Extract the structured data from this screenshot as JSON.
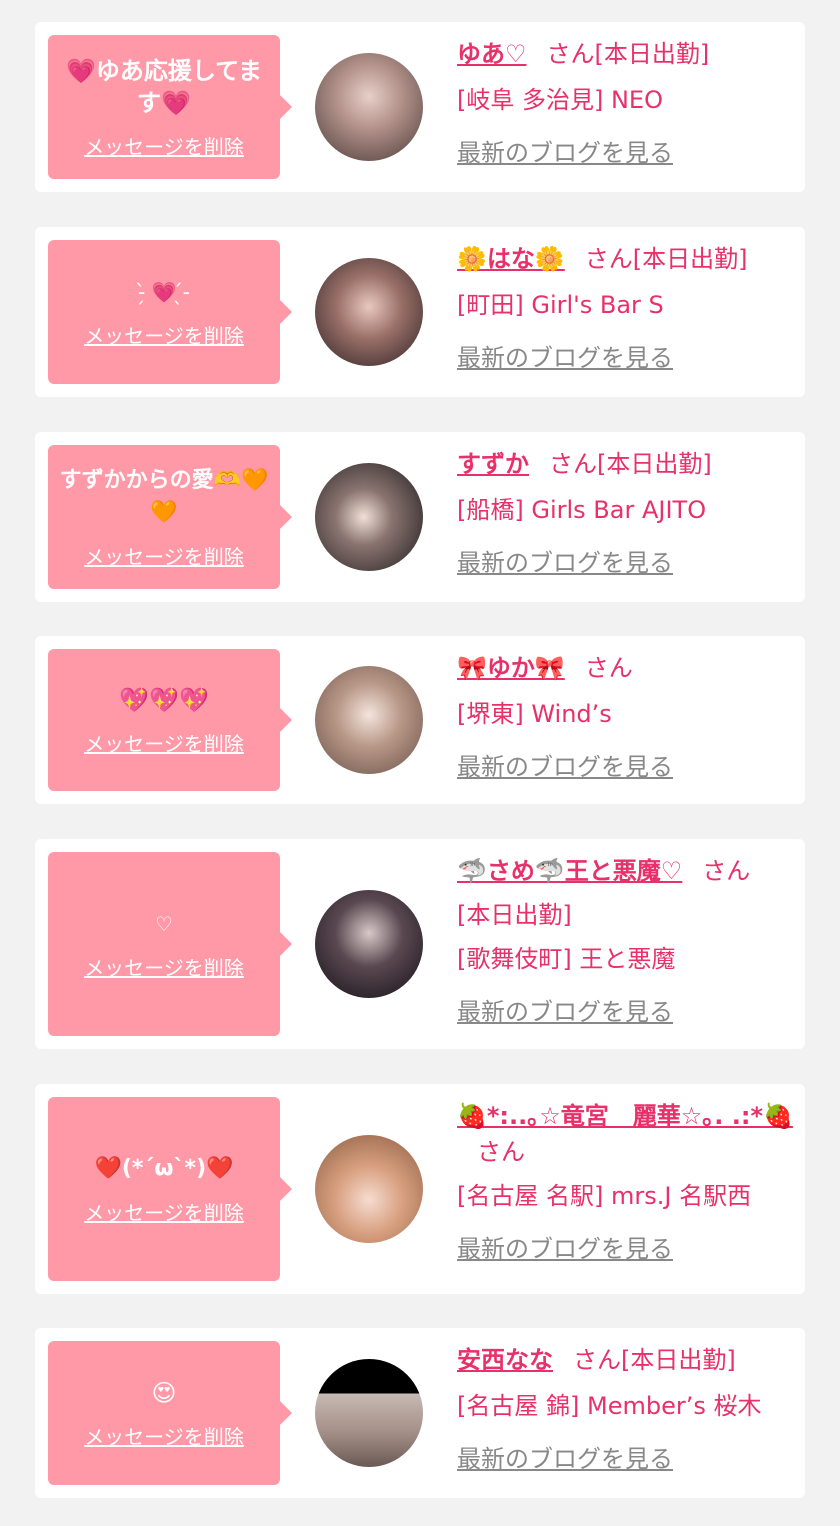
{
  "delete_label": "メッセージを削除",
  "blog_label": "最新のブログを見る",
  "san_label": "さん",
  "colors": {
    "background": "#f2f2f2",
    "card": "#ffffff",
    "bubble": "#ff99a8",
    "accent": "#e8306a",
    "link_gray": "#888888"
  },
  "cards": [
    {
      "message": "💗ゆあ応援してます💗",
      "name": "ゆあ♡",
      "status": "[本日出勤]",
      "shop": "[岐阜 多治見] NEO"
    },
    {
      "message": "-̗̀ 💗 ̖́-",
      "name": "🌼はな🌼",
      "status": "[本日出勤]",
      "shop": "[町田] Girl's Bar S"
    },
    {
      "message": "すずかからの愛🫶🧡🧡",
      "name": "すずか",
      "status": "[本日出勤]",
      "shop": "[船橋] Girls Bar AJITO"
    },
    {
      "message": "💖💖💖",
      "name": "🎀ゆか🎀",
      "status": "",
      "shop": "[堺東] Wind’s"
    },
    {
      "message": "♡",
      "name": "🦈さめ🦈王と悪魔♡",
      "status": "[本日出勤]",
      "shop": "[歌舞伎町] 王と悪魔"
    },
    {
      "message": "❤️(*´ω`*)❤️",
      "name": "🍓*:..｡☆竜宮　麗華☆｡. .:*🍓",
      "status": "",
      "shop": "[名古屋 名駅] mrs.J 名駅西"
    },
    {
      "message": "😍",
      "name": "安西なな",
      "status": "[本日出勤]",
      "shop": "[名古屋 錦] Member’s 桜木"
    }
  ]
}
